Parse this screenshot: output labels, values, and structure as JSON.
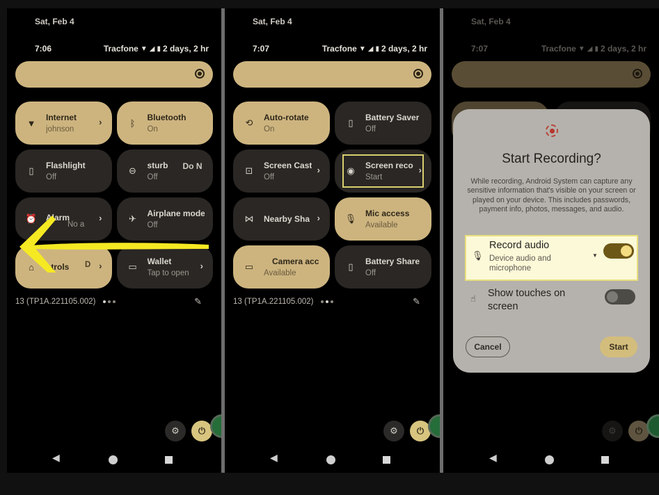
{
  "panels": [
    {
      "date": "Sat, Feb 4",
      "time": "7:06",
      "carrier": "Tracfone",
      "battery": "2 days, 2 hr",
      "tiles": [
        {
          "title": "Internet",
          "subtitle": "johnson",
          "icon": "wifi-icon",
          "state": "on",
          "chevron": true
        },
        {
          "title": "Bluetooth",
          "subtitle": "On",
          "icon": "bluetooth-icon",
          "state": "on",
          "chevron": false
        },
        {
          "title": "Flashlight",
          "subtitle": "Off",
          "icon": "flashlight-icon",
          "state": "off",
          "chevron": false
        },
        {
          "title": "sturb",
          "subtitle": "Off",
          "extra": "Do N",
          "icon": "do-not-disturb-icon",
          "state": "off",
          "chevron": false
        },
        {
          "title": "Alarm",
          "subtitle": "",
          "extra2": "No a",
          "icon": "alarm-icon",
          "state": "off",
          "chevron": true
        },
        {
          "title": "Airplane mode",
          "subtitle": "Off",
          "icon": "airplane-icon",
          "state": "off",
          "chevron": false
        },
        {
          "title": "ntrols",
          "subtitle": "",
          "extra2": "D",
          "icon": "home-icon",
          "state": "on",
          "chevron": true
        },
        {
          "title": "Wallet",
          "subtitle": "Tap to open",
          "icon": "wallet-icon",
          "state": "off",
          "chevron": true
        }
      ],
      "build": "13 (TP1A.221105.002)"
    },
    {
      "date": "Sat, Feb 4",
      "time": "7:07",
      "carrier": "Tracfone",
      "battery": "2 days, 2 hr",
      "tiles": [
        {
          "title": "Auto-rotate",
          "subtitle": "On",
          "icon": "auto-rotate-icon",
          "state": "on",
          "chevron": false
        },
        {
          "title": "Battery Saver",
          "subtitle": "Off",
          "icon": "battery-saver-icon",
          "state": "off",
          "chevron": false
        },
        {
          "title": "Screen Cast",
          "subtitle": "Off",
          "icon": "cast-icon",
          "state": "off",
          "chevron": true
        },
        {
          "title": "Screen reco",
          "subtitle": "Start",
          "icon": "screen-record-icon",
          "state": "off",
          "chevron": true,
          "highlighted": true
        },
        {
          "title": "Nearby Sha",
          "subtitle": "",
          "icon": "nearby-share-icon",
          "state": "off",
          "chevron": true
        },
        {
          "title": "Mic access",
          "subtitle": "Available",
          "icon": "mic-icon",
          "state": "on",
          "chevron": false
        },
        {
          "title": "Camera acc",
          "subtitle": "Available",
          "icon": "camera-icon",
          "state": "on",
          "chevron": false
        },
        {
          "title": "Battery Share",
          "subtitle": "Off",
          "icon": "battery-share-icon",
          "state": "off",
          "chevron": false
        }
      ],
      "build": "13 (TP1A.221105.002)"
    },
    {
      "date": "Sat, Feb 4",
      "time": "7:07",
      "carrier": "Tracfone",
      "battery": "2 days, 2 hr"
    }
  ],
  "dialog": {
    "title": "Start Recording?",
    "body": "While recording, Android System can capture any sensitive information that's visible on your screen or played on your device. This includes passwords, payment info, photos, messages, and audio.",
    "record_audio": {
      "label": "Record audio",
      "sublabel": "Device audio and microphone",
      "enabled": true
    },
    "show_touches": {
      "label": "Show touches on screen",
      "enabled": false
    },
    "cancel_label": "Cancel",
    "start_label": "Start"
  },
  "colors": {
    "tile_on": "#cdb47f",
    "tile_off": "#2a2724",
    "highlight": "#d8cf6e",
    "arrow": "#f5e923",
    "record_red": "#b8352d"
  }
}
